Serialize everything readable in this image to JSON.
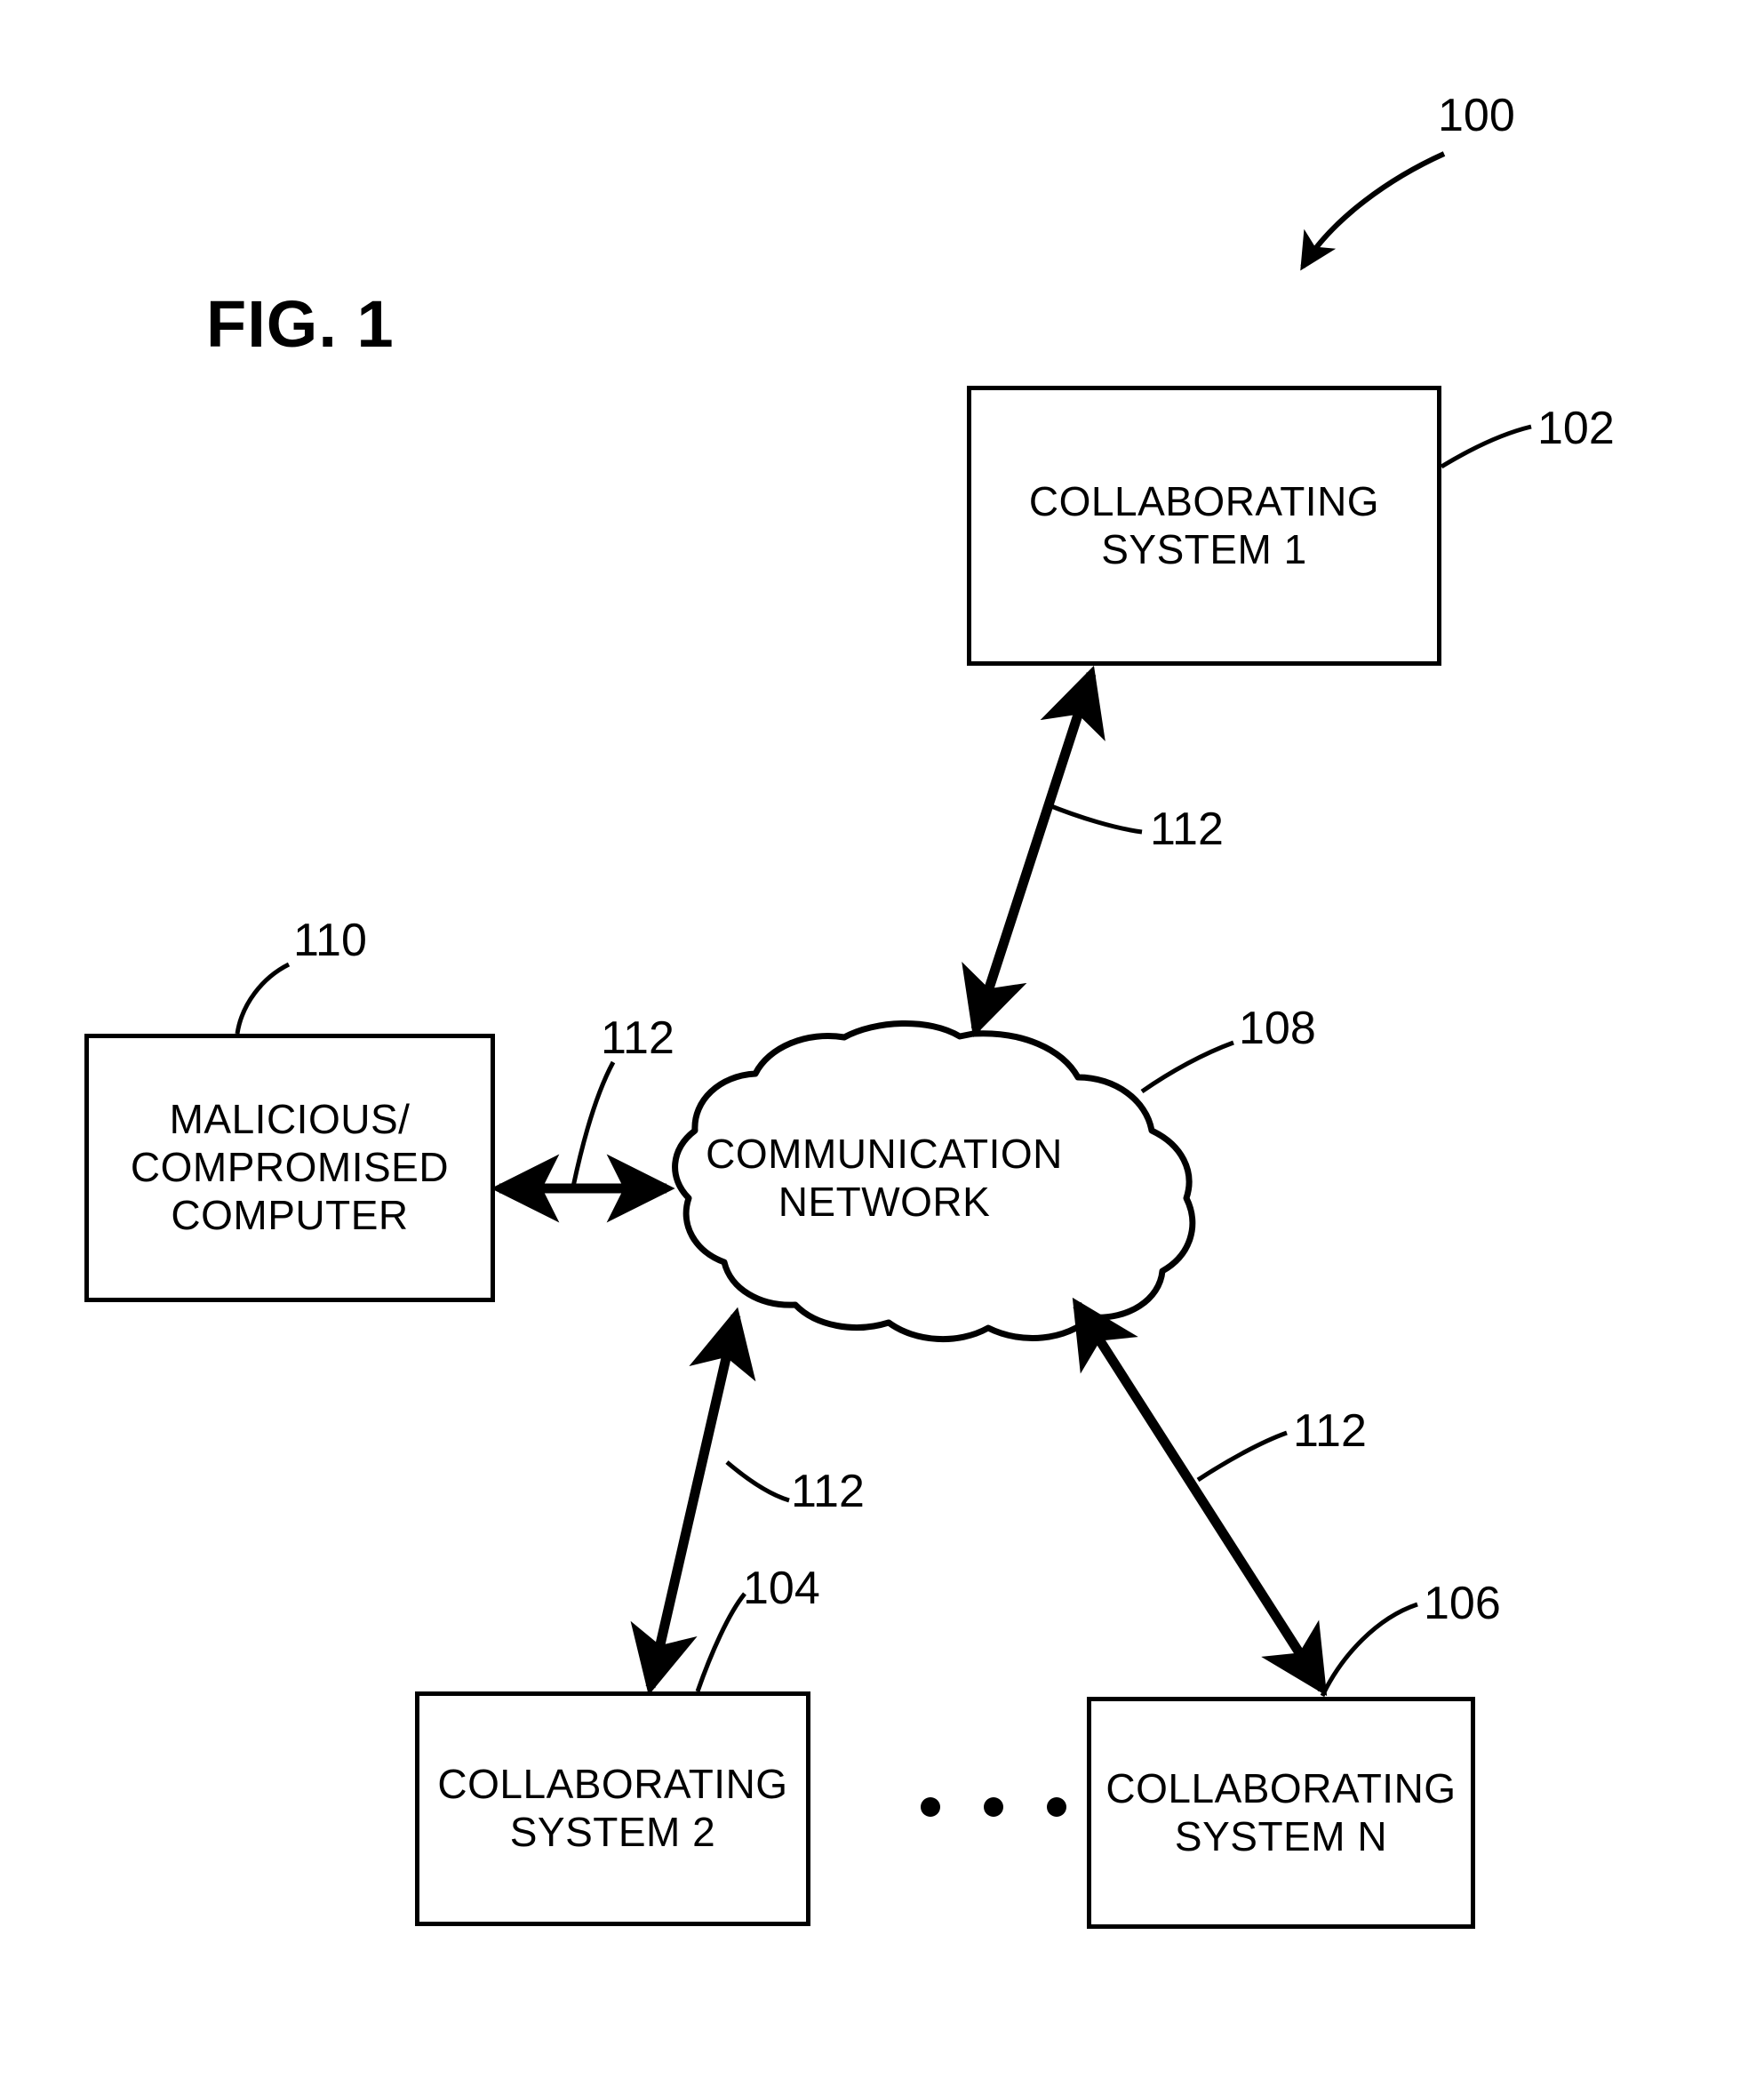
{
  "figure": {
    "title": "FIG. 1",
    "system_ref": "100"
  },
  "nodes": [
    {
      "id": "collaborating-system-1",
      "label": "COLLABORATING\nSYSTEM 1",
      "ref": "102"
    },
    {
      "id": "collaborating-system-2",
      "label": "COLLABORATING\nSYSTEM 2",
      "ref": "104"
    },
    {
      "id": "collaborating-system-n",
      "label": "COLLABORATING\nSYSTEM N",
      "ref": "106"
    },
    {
      "id": "malicious-compromised-computer",
      "label": "MALICIOUS/\nCOMPROMISED\nCOMPUTER",
      "ref": "110"
    }
  ],
  "cloud": {
    "id": "communication-network",
    "label": "COMMUNICATION\nNETWORK",
    "ref": "108"
  },
  "links": [
    {
      "id": "link-network-system1",
      "ref": "112"
    },
    {
      "id": "link-network-malicious",
      "ref": "112"
    },
    {
      "id": "link-network-system2",
      "ref": "112"
    },
    {
      "id": "link-network-systemn",
      "ref": "112"
    }
  ],
  "ellipsis": {
    "label": "• • •",
    "dot_count": 3
  },
  "colors": {
    "stroke": "#000000",
    "background": "#ffffff"
  }
}
